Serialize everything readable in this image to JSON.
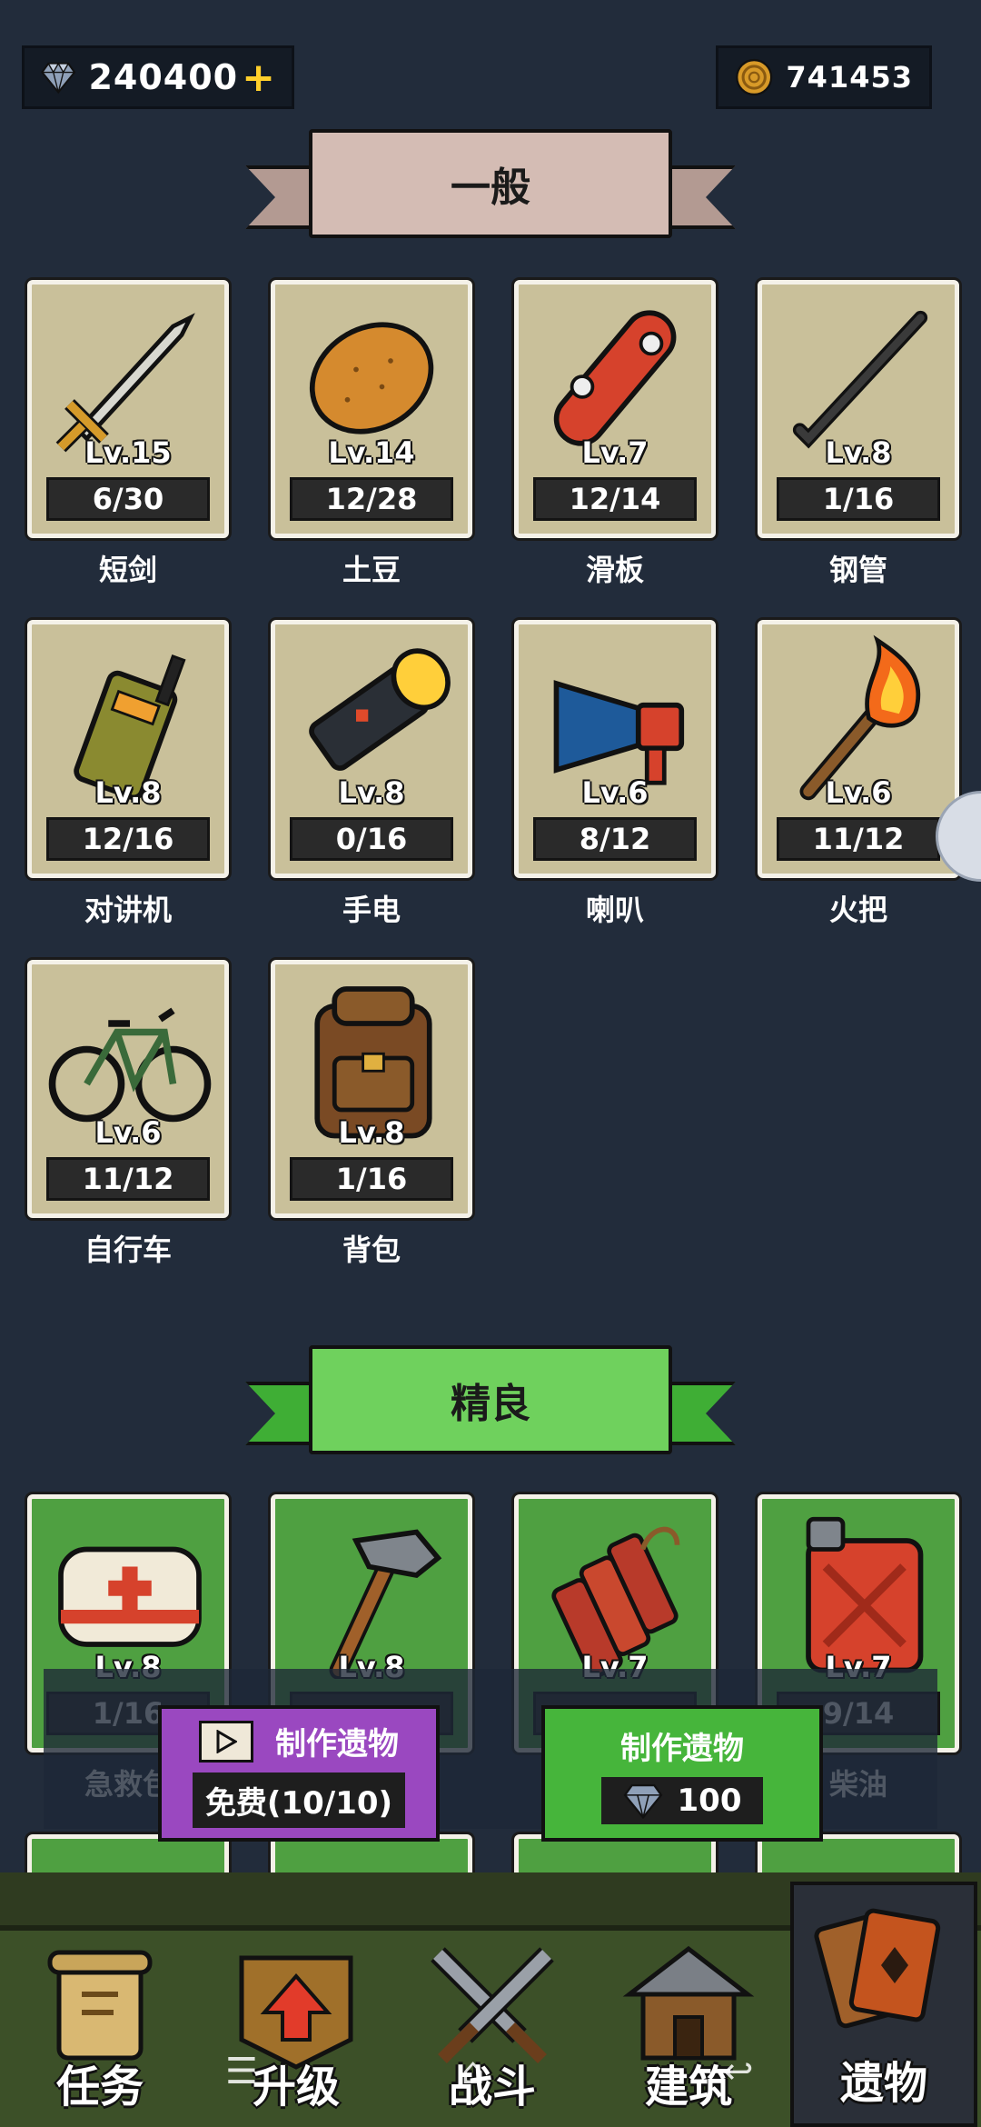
{
  "currency": {
    "gems": "240400",
    "gems_plus": "+",
    "coins": "741453"
  },
  "sections": {
    "common_title": "一般",
    "fine_title": "精良"
  },
  "common_items": [
    {
      "name": "短剑",
      "level": "Lv.15",
      "progress": "6/30",
      "icon": "sword-icon"
    },
    {
      "name": "土豆",
      "level": "Lv.14",
      "progress": "12/28",
      "icon": "potato-icon"
    },
    {
      "name": "滑板",
      "level": "Lv.7",
      "progress": "12/14",
      "icon": "skateboard-icon"
    },
    {
      "name": "钢管",
      "level": "Lv.8",
      "progress": "1/16",
      "icon": "steel-pipe-icon"
    },
    {
      "name": "对讲机",
      "level": "Lv.8",
      "progress": "12/16",
      "icon": "walkie-talkie-icon"
    },
    {
      "name": "手电",
      "level": "Lv.8",
      "progress": "0/16",
      "icon": "flashlight-icon"
    },
    {
      "name": "喇叭",
      "level": "Lv.6",
      "progress": "8/12",
      "icon": "megaphone-icon"
    },
    {
      "name": "火把",
      "level": "Lv.6",
      "progress": "11/12",
      "icon": "torch-icon"
    },
    {
      "name": "自行车",
      "level": "Lv.6",
      "progress": "11/12",
      "icon": "bicycle-icon"
    },
    {
      "name": "背包",
      "level": "Lv.8",
      "progress": "1/16",
      "icon": "backpack-icon"
    }
  ],
  "fine_items": [
    {
      "name": "急救包",
      "level": "Lv.8",
      "progress": "1/16",
      "icon": "first-aid-kit-icon"
    },
    {
      "name": "",
      "level": "Lv.8",
      "progress": "",
      "icon": "hammer-icon"
    },
    {
      "name": "",
      "level": "Lv.7",
      "progress": "",
      "icon": "dynamite-icon"
    },
    {
      "name": "柴油",
      "level": "Lv.7",
      "progress": "9/14",
      "icon": "jerry-can-icon"
    }
  ],
  "craft": {
    "free_title": "制作遗物",
    "free_label": "免费(10/10)",
    "gem_title": "制作遗物",
    "gem_cost": "100"
  },
  "nav": [
    {
      "label": "任务",
      "icon": "scroll-icon"
    },
    {
      "label": "升级",
      "icon": "upgrade-arrow-icon"
    },
    {
      "label": "战斗",
      "icon": "crossed-swords-icon"
    },
    {
      "label": "建筑",
      "icon": "hut-icon"
    },
    {
      "label": "遗物",
      "icon": "cards-icon"
    }
  ],
  "colors": {
    "background": "#222c3b",
    "common_card": "#c9c09a",
    "fine_card": "#4fa041",
    "purple_button": "#9a48c0",
    "green_button": "#46b53b",
    "gold_plus": "#ffcf2b"
  }
}
